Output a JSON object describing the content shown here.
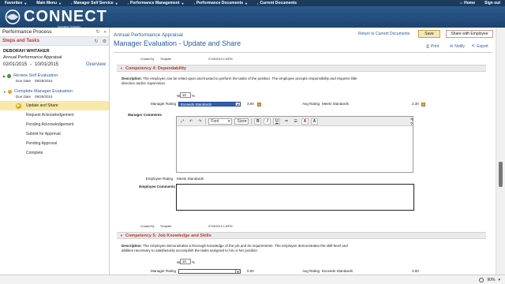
{
  "topnav": {
    "items": [
      "Favorites",
      "Main Menu",
      "Manager Self Service",
      "Performance Management",
      "Performance Documents",
      "Current Documents"
    ],
    "home": "Home",
    "signout": "Sign out"
  },
  "banner": {
    "logo": "CONNECT",
    "sub": "Maryland Judiciary"
  },
  "left": {
    "title": "Performance Process",
    "steps_title": "Steps and Tasks",
    "employee": "DEBORAH WHITAKER",
    "doc_type": "Annual Performance Appraisal",
    "date_from": "02/01/2015",
    "date_to": "10/01/2015",
    "overview": "Overview",
    "step1": {
      "title": "Review Self Evaluation",
      "due_label": "Due Date",
      "due": "09/29/2015"
    },
    "step2": {
      "title": "Complete Manager Evaluation",
      "due_label": "Due Date",
      "due": "09/29/2015"
    },
    "tasks": [
      "Update and Share",
      "Request Acknowledgement",
      "Pending Acknowledgement",
      "Submit for Approval",
      "Pending Approval",
      "Complete"
    ]
  },
  "main": {
    "doc_title": "Annual Performance Appraisal",
    "page_title": "Manager Evaluation - Update and Share",
    "return_link": "Return to Current Documents",
    "save_label": "Save",
    "share_label": "Share with Employee",
    "print": "Print",
    "notify": "Notify",
    "export": "Export",
    "meta1_label": "Created By",
    "meta1_value": "Template",
    "meta1_date": "07/28/2015  1:30PM",
    "comp4": {
      "title": "Competency 4: Dependability",
      "desc_label": "Description",
      "desc": ": The employee can be relied upon and trusted to perform the tasks of the position. The employee accepts responsibility and requires little direction and/or supervision.",
      "weight_label": "Weight",
      "weight": "10",
      "pct": "%",
      "rating_label": "Manager Rating",
      "rating_value": "Exceeds Standards",
      "rating_num": "3.00",
      "avg_label": "Avg Rating",
      "avg_value": "Meets Standards",
      "avg_num": "2.30",
      "mgr_comments_label": "Manager Comments",
      "font_combo": "Font",
      "size_combo": "Size",
      "emp_rating_label": "Employee Rating",
      "emp_rating_value": "Meets Standards",
      "emp_comments_label": "Employee Comments"
    },
    "meta2_label": "Created By",
    "meta2_value": "Template",
    "meta2_date": "07/28/2015  1:30PM",
    "comp5": {
      "title": "Competency 5: Job Knowledge and Skills",
      "desc_label": "Description",
      "desc": ": The employee demonstrates a thorough knowledge of the job and its requirements. The employee demonstrates the skill-level and abilities necessary to satisfactorily accomplish the tasks assigned to his or her position.",
      "weight_label": "Weight",
      "weight": "10",
      "pct": "%",
      "rating_label": "Manager Rating",
      "rating_num": "0.00",
      "avg_label": "Avg Rating",
      "avg_value": "Exceeds Standards",
      "avg_num": "3.00"
    }
  },
  "status": {
    "zoom": "90%"
  }
}
